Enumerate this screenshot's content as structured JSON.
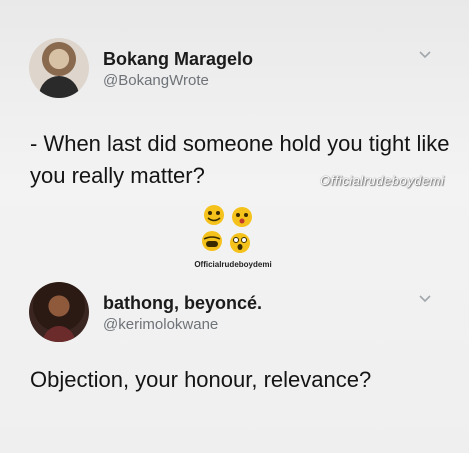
{
  "tweets": [
    {
      "author_name": "Bokang Maragelo",
      "author_handle": "@BokangWrote",
      "text": "- When last did someone hold you tight like you really matter?",
      "menu_icon": "chevron-down-icon"
    },
    {
      "author_name": "bathong, beyoncé.",
      "author_handle": "@kerimolokwane",
      "text": "Objection, your honour, relevance?",
      "menu_icon": "chevron-down-icon"
    }
  ],
  "watermark": "Officialrudeboydemi",
  "logo": {
    "caption": "Officialrudeboydemi",
    "icon": "emoji-cluster-logo"
  },
  "colors": {
    "background": "#ececec",
    "name": "#1b1b1b",
    "handle": "#6e7378",
    "chevron": "#a2a7ab"
  }
}
